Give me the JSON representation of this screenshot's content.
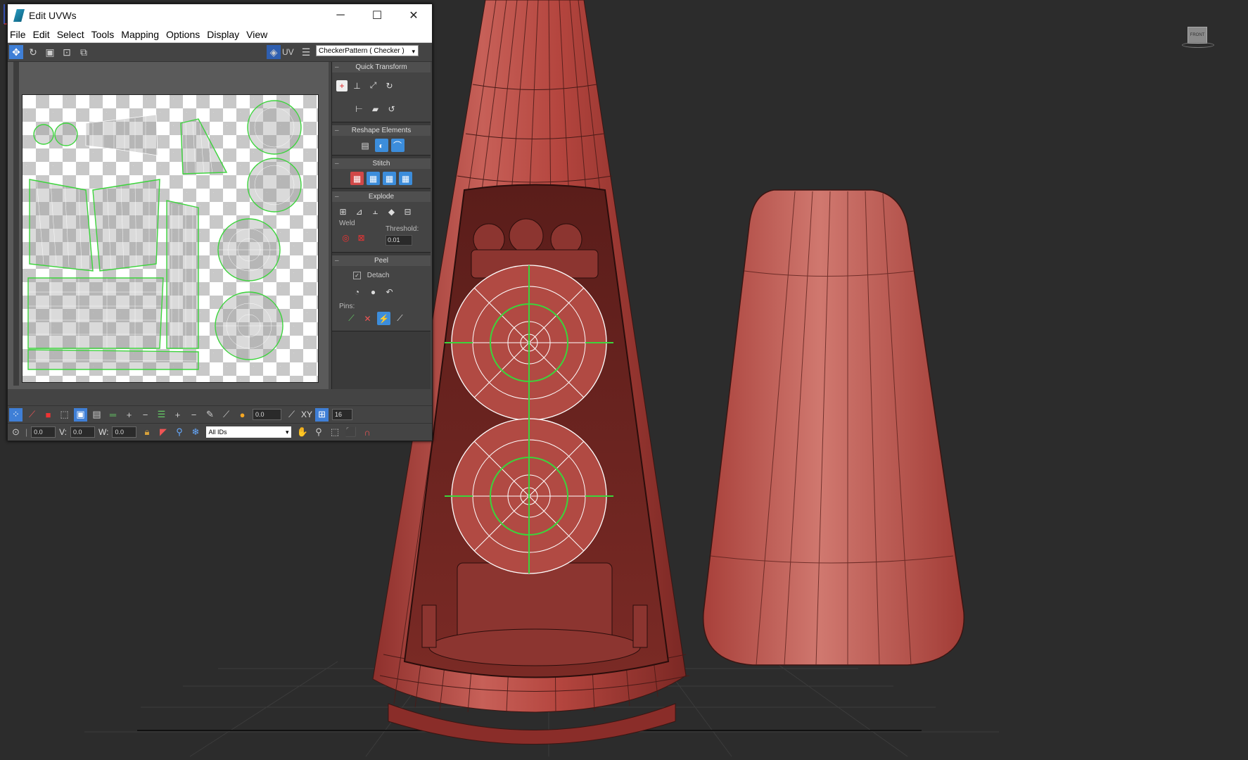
{
  "window": {
    "title": "Edit UVWs",
    "minimize": "─",
    "maximize": "☐",
    "close": "✕"
  },
  "menu": [
    "File",
    "Edit",
    "Select",
    "Tools",
    "Mapping",
    "Options",
    "Display",
    "View"
  ],
  "toolbar": {
    "uv_label": "UV",
    "texture_select": "CheckerPattern  ( Checker )"
  },
  "panels": {
    "quick_transform": "Quick Transform",
    "reshape_elements": "Reshape Elements",
    "stitch": "Stitch",
    "explode": "Explode",
    "weld_label": "Weld",
    "threshold_label": "Threshold:",
    "threshold_value": "0.01",
    "peel": "Peel",
    "detach_label": "Detach",
    "detach_checked": true,
    "pins_label": "Pins:"
  },
  "bottom": {
    "spinner_value": "0.0",
    "xy_label": "XY",
    "grid_value": "16",
    "u_value": "0.0",
    "v_label": "V:",
    "v_value": "0.0",
    "w_label": "W:",
    "w_value": "0.0",
    "ids_select": "All IDs"
  },
  "viewport": {
    "cube_label": "FRONT",
    "model_color": "#b84a44",
    "wire_color": "#3a1512",
    "selected_wire_color": "#ffffff",
    "seam_color": "#3cd43c"
  }
}
